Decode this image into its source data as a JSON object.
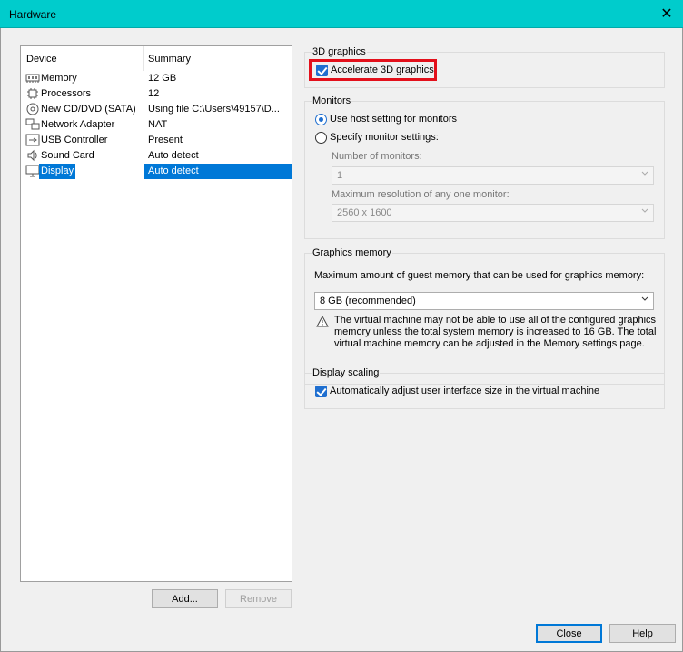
{
  "window": {
    "title": "Hardware"
  },
  "device_list": {
    "header_device": "Device",
    "header_summary": "Summary",
    "rows": [
      {
        "name": "Memory",
        "summary": "12 GB",
        "icon": "memory-icon"
      },
      {
        "name": "Processors",
        "summary": "12",
        "icon": "processor-icon"
      },
      {
        "name": "New CD/DVD (SATA)",
        "summary": "Using file C:\\Users\\49157\\D...",
        "icon": "cd-dvd-icon"
      },
      {
        "name": "Network Adapter",
        "summary": "NAT",
        "icon": "network-icon"
      },
      {
        "name": "USB Controller",
        "summary": "Present",
        "icon": "usb-icon"
      },
      {
        "name": "Sound Card",
        "summary": "Auto detect",
        "icon": "sound-icon"
      },
      {
        "name": "Display",
        "summary": "Auto detect",
        "icon": "display-icon",
        "selected": true
      }
    ],
    "add_label": "Add...",
    "remove_label": "Remove"
  },
  "graphics3d": {
    "legend": "3D graphics",
    "accelerate_label": "Accelerate 3D graphics",
    "accelerate_checked": true
  },
  "monitors": {
    "legend": "Monitors",
    "use_host_label": "Use host setting for monitors",
    "specify_label": "Specify monitor settings:",
    "selected": "use_host",
    "num_label": "Number of monitors:",
    "num_value": "1",
    "maxres_label": "Maximum resolution of any one monitor:",
    "maxres_value": "2560 x 1600"
  },
  "graphics_memory": {
    "legend": "Graphics memory",
    "desc": "Maximum amount of guest memory that can be used for graphics memory:",
    "value": "8 GB (recommended)",
    "warning_line1": "The virtual machine may not be able to use all of the configured graphics",
    "warning_line2": "memory unless the total system memory is increased to 16 GB. The total",
    "warning_line3": "virtual machine memory can be adjusted in the Memory settings page."
  },
  "display_scaling": {
    "legend": "Display scaling",
    "auto_label": "Automatically adjust user interface size in the virtual machine",
    "auto_checked": true
  },
  "footer": {
    "close_label": "Close",
    "help_label": "Help"
  },
  "colors": {
    "titlebar": "#00cccc",
    "selection": "#0078d7",
    "highlight": "#e3101b"
  }
}
